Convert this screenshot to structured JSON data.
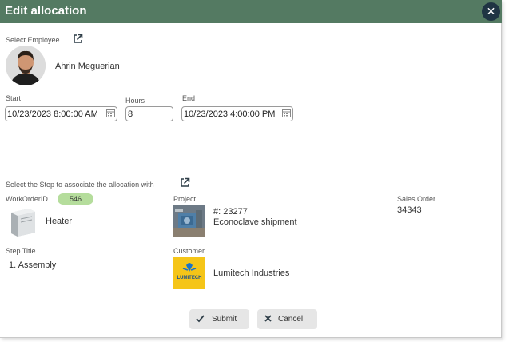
{
  "dialog": {
    "title": "Edit allocation",
    "close_icon": "close-icon"
  },
  "employee": {
    "section_label": "Select Employee",
    "link_icon": "external-link-icon",
    "name": "Ahrin Meguerian"
  },
  "schedule": {
    "start_label": "Start",
    "start_value": "10/23/2023 8:00:00 AM",
    "hours_label": "Hours",
    "hours_value": "8",
    "end_label": "End",
    "end_value": "10/23/2023 4:00:00 PM",
    "calendar_icon": "calendar-icon"
  },
  "step": {
    "section_label": "Select the Step to associate the allocation with",
    "link_icon": "external-link-icon",
    "work_order_label": "WorkOrderID",
    "work_order_id": "546",
    "work_order_name": "Heater",
    "project_label": "Project",
    "project_number": "#: 23277",
    "project_name": "Econoclave shipment",
    "sales_order_label": "Sales Order",
    "sales_order_value": "34343",
    "step_title_label": "Step Title",
    "step_title_value": "1. Assembly",
    "customer_label": "Customer",
    "customer_name": "Lumitech Industries",
    "customer_logo_text": "LUMITECH"
  },
  "actions": {
    "submit_label": "Submit",
    "cancel_label": "Cancel"
  },
  "colors": {
    "titlebar": "#547a62",
    "close_button": "#1f3443",
    "badge": "#b5dd9c",
    "button": "#e6e6e6",
    "logo_bg": "#f5c518"
  }
}
